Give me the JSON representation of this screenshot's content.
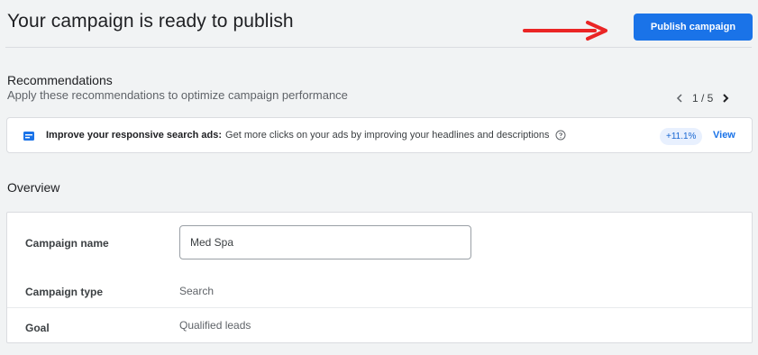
{
  "header": {
    "title": "Your campaign is ready to publish",
    "publish_label": "Publish campaign"
  },
  "recommendations": {
    "title": "Recommendations",
    "subtitle": "Apply these recommendations to optimize campaign performance",
    "pager_text": "1 / 5",
    "card": {
      "headline": "Improve your responsive search ads:",
      "body": "Get more clicks on your ads by improving your headlines and descriptions",
      "uplift": "+11.1%",
      "action_label": "View"
    }
  },
  "overview": {
    "title": "Overview",
    "campaign_name_label": "Campaign name",
    "campaign_name_value": "Med Spa",
    "campaign_type_label": "Campaign type",
    "campaign_type_value": "Search",
    "goal_label": "Goal",
    "goal_value": "Qualified leads"
  },
  "icons": {
    "arrow": "right-arrow-icon",
    "prev": "chevron-left-icon",
    "next": "chevron-right-icon",
    "recommendation": "ad-recommendation-icon",
    "help": "help-circle-icon"
  },
  "colors": {
    "accent": "#1a73e8",
    "arrow": "#ea2525",
    "uplift_bg": "#e8f0fe"
  }
}
